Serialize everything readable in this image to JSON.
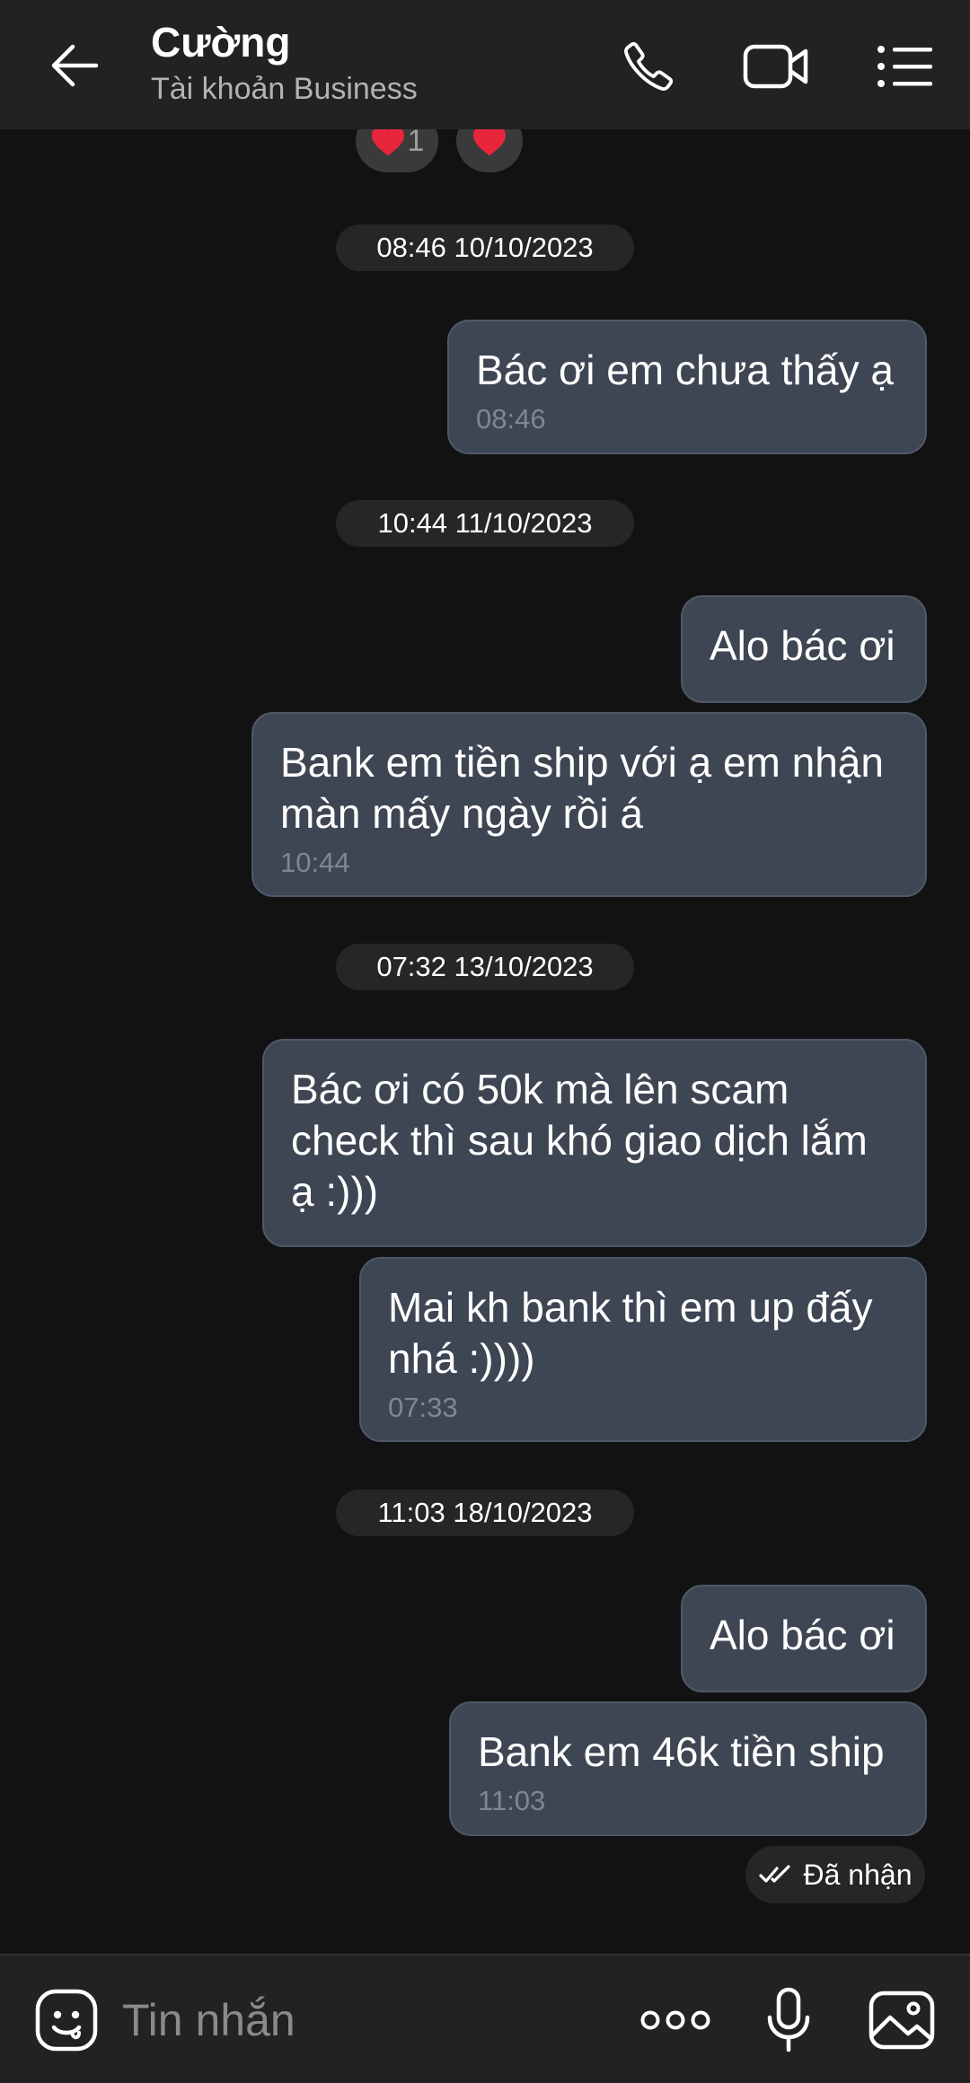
{
  "header": {
    "contact_name": "Cường",
    "subtitle": "Tài khoản Business",
    "icons": {
      "back": "arrow-left-icon",
      "call": "phone-icon",
      "video": "video-camera-icon",
      "menu": "list-menu-icon"
    }
  },
  "reactions": [
    {
      "icon": "heart-icon",
      "count": "1"
    },
    {
      "icon": "heart-icon",
      "count": ""
    }
  ],
  "date_separators": [
    "08:46 10/10/2023",
    "10:44 11/10/2023",
    "07:32 13/10/2023",
    "11:03 18/10/2023"
  ],
  "messages": [
    {
      "text": "Bác ơi em chưa thấy ạ",
      "time": "08:46"
    },
    {
      "text": "Alo bác ơi",
      "time": ""
    },
    {
      "text": "Bank em tiền ship với ạ em nhận màn mấy ngày rồi á",
      "time": "10:44"
    },
    {
      "text": "Bác ơi có 50k mà lên scam check thì sau khó giao dịch lắm ạ :)))",
      "time": ""
    },
    {
      "text": "Mai kh bank thì em up đấy nhá :))))",
      "time": "07:33"
    },
    {
      "text": "Alo bác ơi",
      "time": ""
    },
    {
      "text": "Bank em 46k tiền ship",
      "time": "11:03"
    }
  ],
  "status": {
    "label": "Đã nhận",
    "icon": "double-check-icon"
  },
  "composer": {
    "placeholder": "Tin nhắn",
    "value": "",
    "icons": {
      "sticker": "sticker-smiley-icon",
      "more": "more-dots-icon",
      "mic": "microphone-icon",
      "image": "image-icon"
    }
  },
  "colors": {
    "background": "#121212",
    "header": "#222222",
    "bubble": "#3e4654",
    "heart": "#e8253b"
  }
}
